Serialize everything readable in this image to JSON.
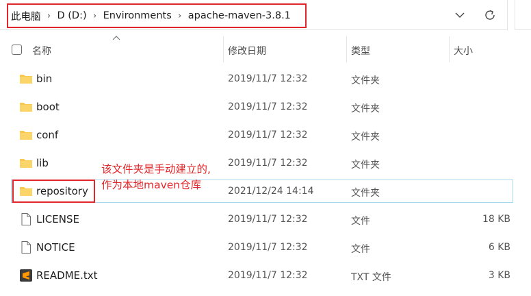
{
  "breadcrumb": [
    "此电脑",
    "D (D:)",
    "Environments",
    "apache-maven-3.8.1"
  ],
  "columns": {
    "name": "名称",
    "modified": "修改日期",
    "type": "类型",
    "size": "大小"
  },
  "files": [
    {
      "name": "bin",
      "modified": "2019/11/7 12:32",
      "type": "文件夹",
      "size": "",
      "icon": "folder-icon"
    },
    {
      "name": "boot",
      "modified": "2019/11/7 12:32",
      "type": "文件夹",
      "size": "",
      "icon": "folder-icon"
    },
    {
      "name": "conf",
      "modified": "2019/11/7 12:32",
      "type": "文件夹",
      "size": "",
      "icon": "folder-icon"
    },
    {
      "name": "lib",
      "modified": "2019/11/7 12:32",
      "type": "文件夹",
      "size": "",
      "icon": "folder-icon"
    },
    {
      "name": "repository",
      "modified": "2021/12/24 14:14",
      "type": "文件夹",
      "size": "",
      "icon": "folder-icon",
      "selected": true
    },
    {
      "name": "LICENSE",
      "modified": "2019/11/7 12:32",
      "type": "文件",
      "size": "18 KB",
      "icon": "file-icon"
    },
    {
      "name": "NOTICE",
      "modified": "2019/11/7 12:32",
      "type": "文件",
      "size": "6 KB",
      "icon": "file-icon"
    },
    {
      "name": "README.txt",
      "modified": "2019/11/7 12:32",
      "type": "TXT 文件",
      "size": "3 KB",
      "icon": "sublime-text-icon"
    }
  ],
  "annotation": {
    "line1": "该文件夹是手动建立的,",
    "line2": "作为本地maven仓库"
  },
  "colors": {
    "highlight": "#e0262a",
    "folder": "#f8c94e",
    "selection_border": "#a8d8ee"
  }
}
